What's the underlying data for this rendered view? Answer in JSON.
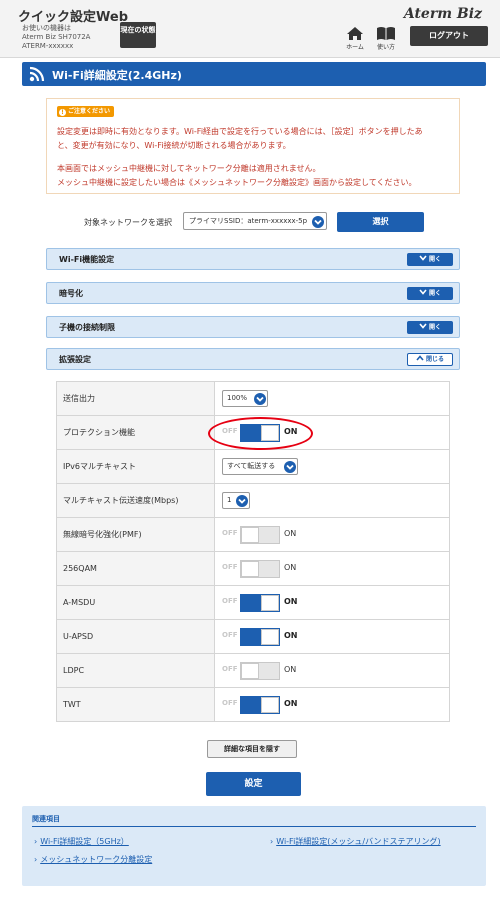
{
  "header": {
    "app_title": "クイック設定Web",
    "device_label": "お使いの機器は",
    "device_model": "Aterm Biz SH7072A",
    "device_id": "ATERM-xxxxxx",
    "status_button": "現在の状態",
    "brand": "Aterm Biz",
    "home_label": "ホーム",
    "guide_label": "使い方",
    "logout_label": "ログアウト"
  },
  "page_title": "Wi-Fi詳細設定(2.4GHz)",
  "notice": {
    "badge": "ご注意ください",
    "lines": [
      "設定変更は即時に有効となります。Wi-Fi経由で設定を行っている場合には、［設定］ボタンを押したあ",
      "と、変更が有効になり、Wi-Fi接続が切断される場合があります。",
      "本画面ではメッシュ中継機に対してネットワーク分離は適用されません。",
      "メッシュ中継機に設定したい場合は《メッシュネットワーク分離設定》画面から設定してください。"
    ]
  },
  "network_select": {
    "label": "対象ネットワークを選択",
    "value": "プライマリSSID：aterm-xxxxxx-5p",
    "button": "選択"
  },
  "sections": [
    {
      "title": "Wi-Fi機能設定",
      "toggle": "開く"
    },
    {
      "title": "暗号化",
      "toggle": "開く"
    },
    {
      "title": "子機の接続制限",
      "toggle": "開く"
    },
    {
      "title": "拡張設定",
      "toggle": "閉じる"
    }
  ],
  "switch_labels": {
    "off": "OFF",
    "on": "ON"
  },
  "settings": [
    {
      "label": "送信出力",
      "type": "select",
      "value": "100%"
    },
    {
      "label": "プロテクション機能",
      "type": "switch",
      "on": true
    },
    {
      "label": "IPv6マルチキャスト",
      "type": "select",
      "value": "すべて転送する"
    },
    {
      "label": "マルチキャスト伝送速度(Mbps)",
      "type": "select",
      "value": "1"
    },
    {
      "label": "無線暗号化強化(PMF)",
      "type": "switch",
      "on": false
    },
    {
      "label": "256QAM",
      "type": "switch",
      "on": false
    },
    {
      "label": "A-MSDU",
      "type": "switch",
      "on": true
    },
    {
      "label": "U-APSD",
      "type": "switch",
      "on": true
    },
    {
      "label": "LDPC",
      "type": "switch",
      "on": false
    },
    {
      "label": "TWT",
      "type": "switch",
      "on": true
    }
  ],
  "hide_items_button": "詳細な項目を隠す",
  "apply_button": "設定",
  "related": {
    "title": "関連項目",
    "links": [
      "Wi-Fi詳細設定（5GHz）",
      "Wi-Fi詳細設定(メッシュ/バンドステアリング)",
      "メッシュネットワーク分離設定"
    ]
  },
  "colors": {
    "primary": "#1d5fb0",
    "section_bg": "#dbe9f7",
    "warning": "#c0392b",
    "badge": "#f39800",
    "highlight": "#e60012"
  }
}
